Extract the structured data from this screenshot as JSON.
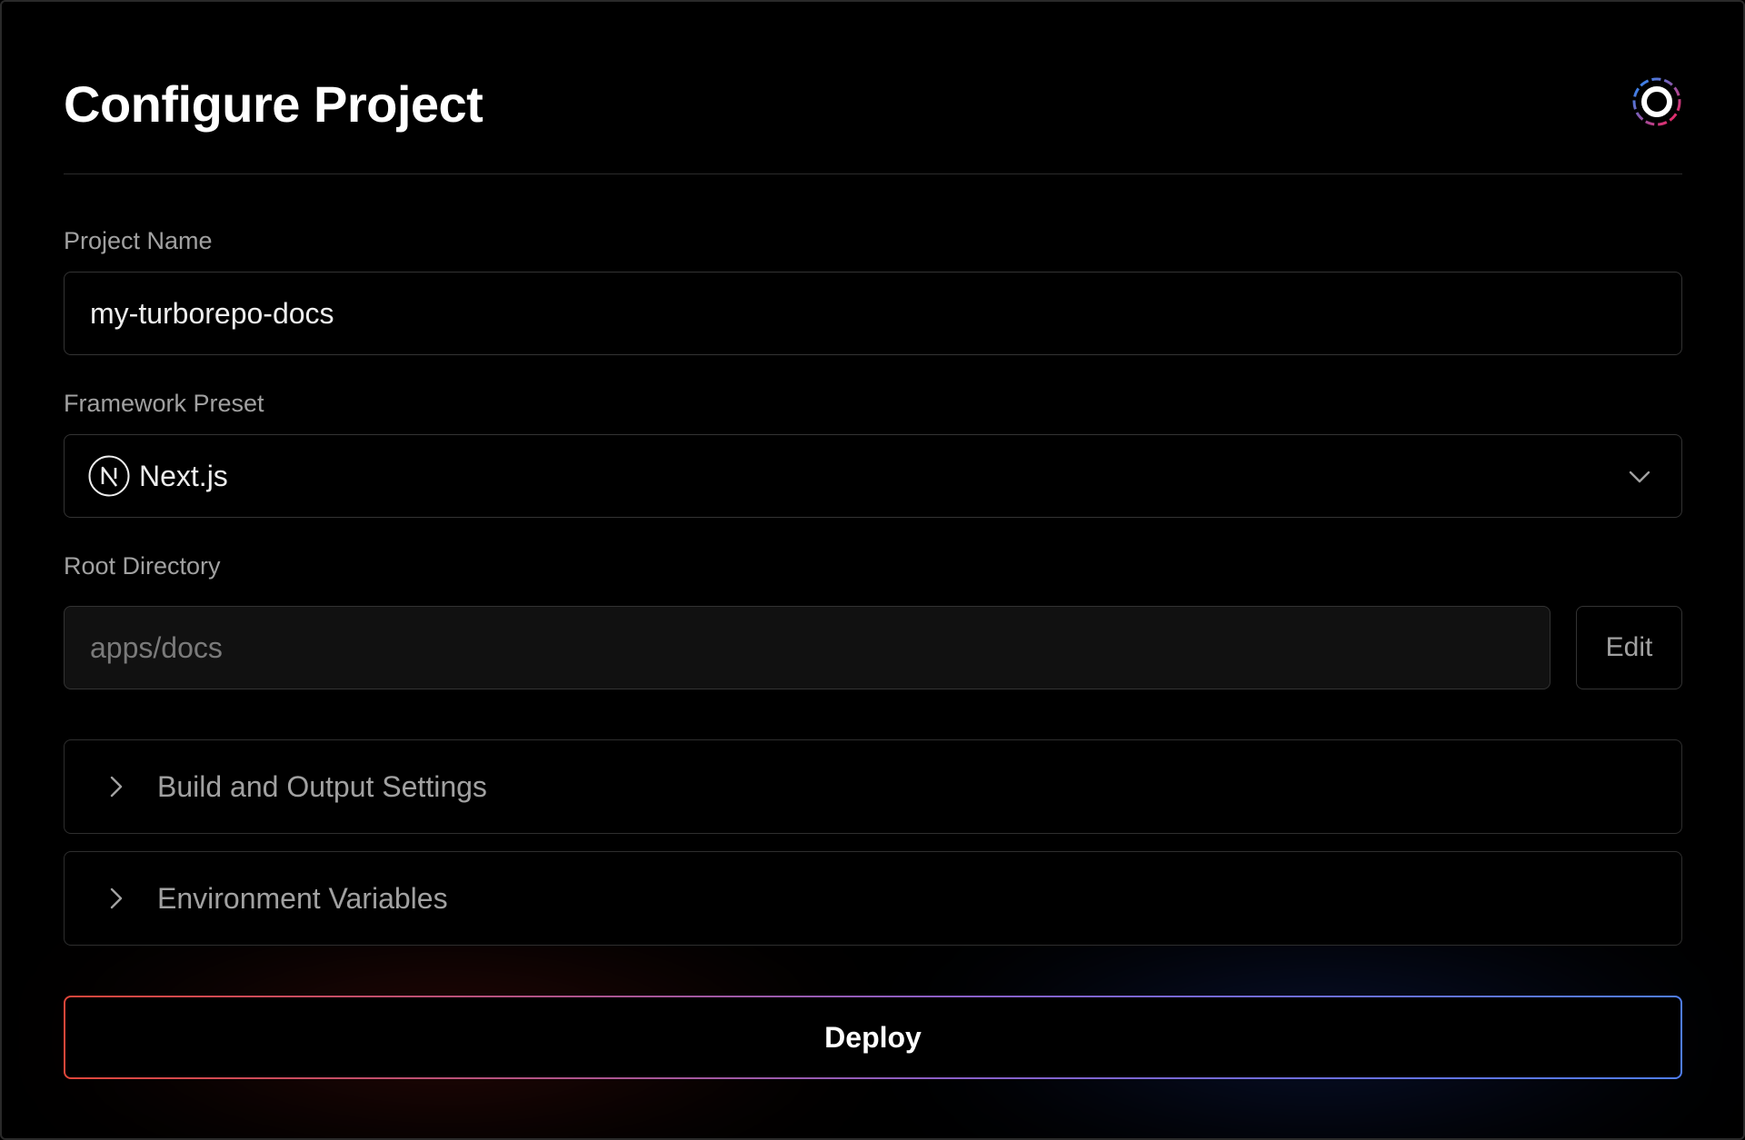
{
  "header": {
    "title": "Configure Project",
    "logo_icon": "turbo-logo-icon"
  },
  "project_name": {
    "label": "Project Name",
    "value": "my-turborepo-docs"
  },
  "framework_preset": {
    "label": "Framework Preset",
    "selected": "Next.js",
    "icon": "nextjs-logo-icon"
  },
  "root_directory": {
    "label": "Root Directory",
    "value": "apps/docs",
    "edit_label": "Edit"
  },
  "sections": [
    {
      "label": "Build and Output Settings",
      "expanded": false
    },
    {
      "label": "Environment Variables",
      "expanded": false
    }
  ],
  "deploy": {
    "label": "Deploy"
  },
  "colors": {
    "background": "#000000",
    "border": "#333333",
    "label_text": "#a1a1a1",
    "gradient_start": "#e0463a",
    "gradient_end": "#4f7df0"
  }
}
